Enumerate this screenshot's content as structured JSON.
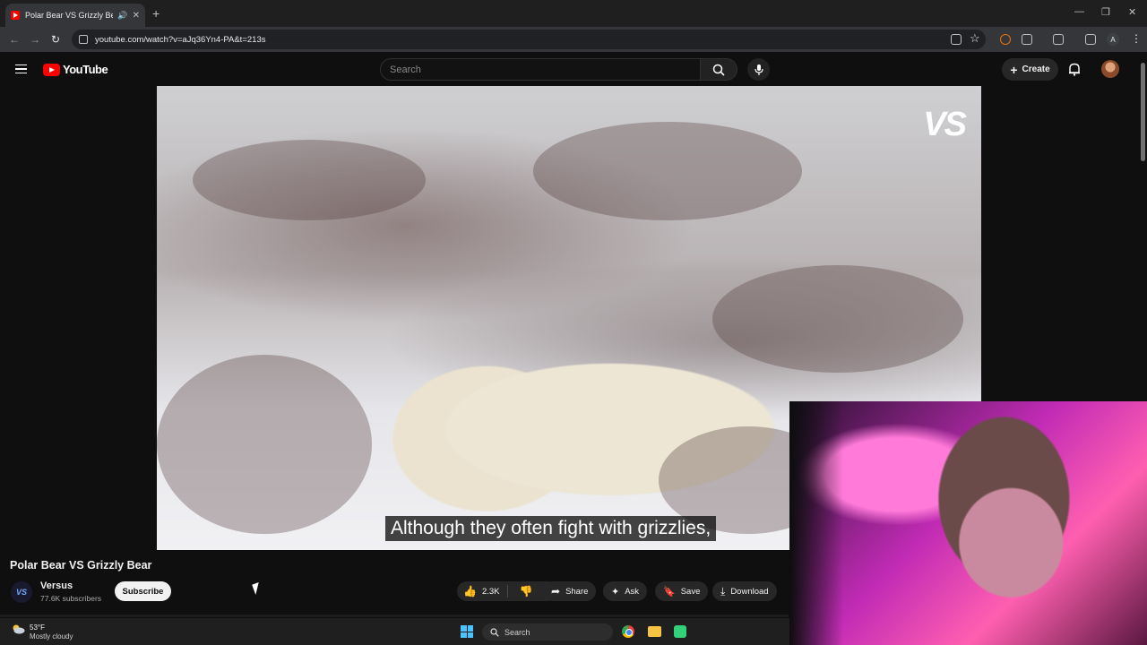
{
  "browser": {
    "tab_title": "Polar Bear VS Grizzly Bear",
    "url": "youtube.com/watch?v=aJq36Yn4-PA&t=213s",
    "profile_initial": "A"
  },
  "youtube": {
    "logo_text": "YouTube",
    "search_placeholder": "Search",
    "create_label": "Create"
  },
  "video": {
    "watermark": "VS",
    "caption": "Although they often fight with grizzlies,",
    "title": "Polar Bear VS Grizzly Bear"
  },
  "channel": {
    "avatar_text": "VS",
    "name": "Versus",
    "subscribers": "77.6K subscribers",
    "subscribe_label": "Subscribe"
  },
  "actions": {
    "likes": "2.3K",
    "share": "Share",
    "ask": "Ask",
    "save": "Save",
    "download": "Download"
  },
  "taskbar": {
    "temperature": "53°F",
    "condition": "Mostly cloudy",
    "search_label": "Search"
  },
  "colors": {
    "youtube_red": "#ff0000",
    "background": "#0f0f0f",
    "chip": "#272727"
  }
}
